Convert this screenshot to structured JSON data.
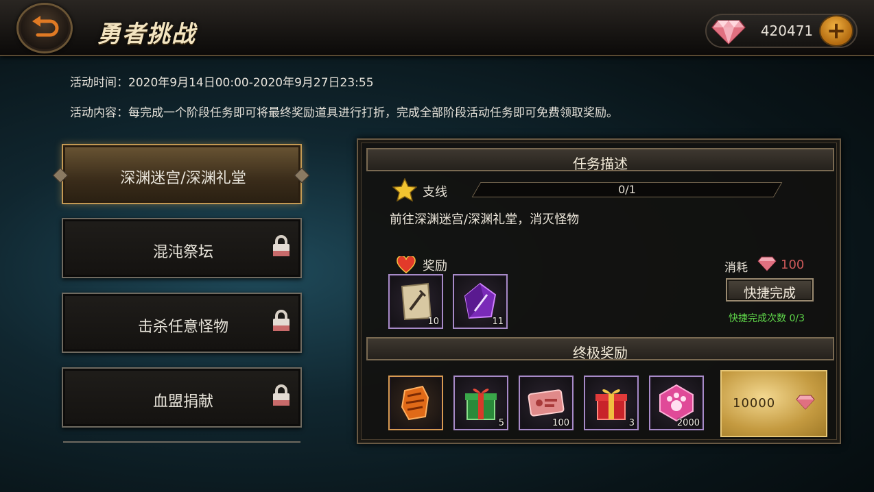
{
  "header": {
    "title": "勇者挑战",
    "currency_amount": "420471"
  },
  "info": {
    "time_label": "活动时间：",
    "time_value": "2020年9月14日00:00-2020年9月27日23:55",
    "content_label": "活动内容：",
    "content_value": "每完成一个阶段任务即可将最终奖励道具进行打折，完成全部阶段活动任务即可免费领取奖励。"
  },
  "tabs": [
    {
      "label": "深渊迷宫/深渊礼堂",
      "locked": false,
      "active": true
    },
    {
      "label": "混沌祭坛",
      "locked": true,
      "active": false
    },
    {
      "label": "击杀任意怪物",
      "locked": true,
      "active": false
    },
    {
      "label": "血盟捐献",
      "locked": true,
      "active": false
    }
  ],
  "task": {
    "section_title": "任务描述",
    "branch_label": "支线",
    "progress_text": "0/1",
    "progress_fraction": 0,
    "description": "前往深渊迷宫/深渊礼堂，消灭怪物",
    "reward_label": "奖励",
    "rewards": [
      {
        "icon": "scroll-icon",
        "count": "10"
      },
      {
        "icon": "purple-crystal-icon",
        "count": "11"
      }
    ],
    "cost_label": "消耗",
    "cost_value": "100",
    "quick_complete_label": "快捷完成",
    "quick_complete_count": "快捷完成次数 0/3"
  },
  "final": {
    "section_title": "终极奖励",
    "items": [
      {
        "icon": "orange-armor-icon",
        "count": ""
      },
      {
        "icon": "green-gift-box-icon",
        "count": "5"
      },
      {
        "icon": "exchange-ticket-icon",
        "count": "100"
      },
      {
        "icon": "red-gift-box-icon",
        "count": "3"
      },
      {
        "icon": "pink-paw-gem-icon",
        "count": "2000"
      }
    ],
    "price_value": "10000"
  },
  "colors": {
    "accent_gold": "#c49a54",
    "cost_red": "#d05a5a",
    "quick_count_green": "#5fd84a"
  }
}
